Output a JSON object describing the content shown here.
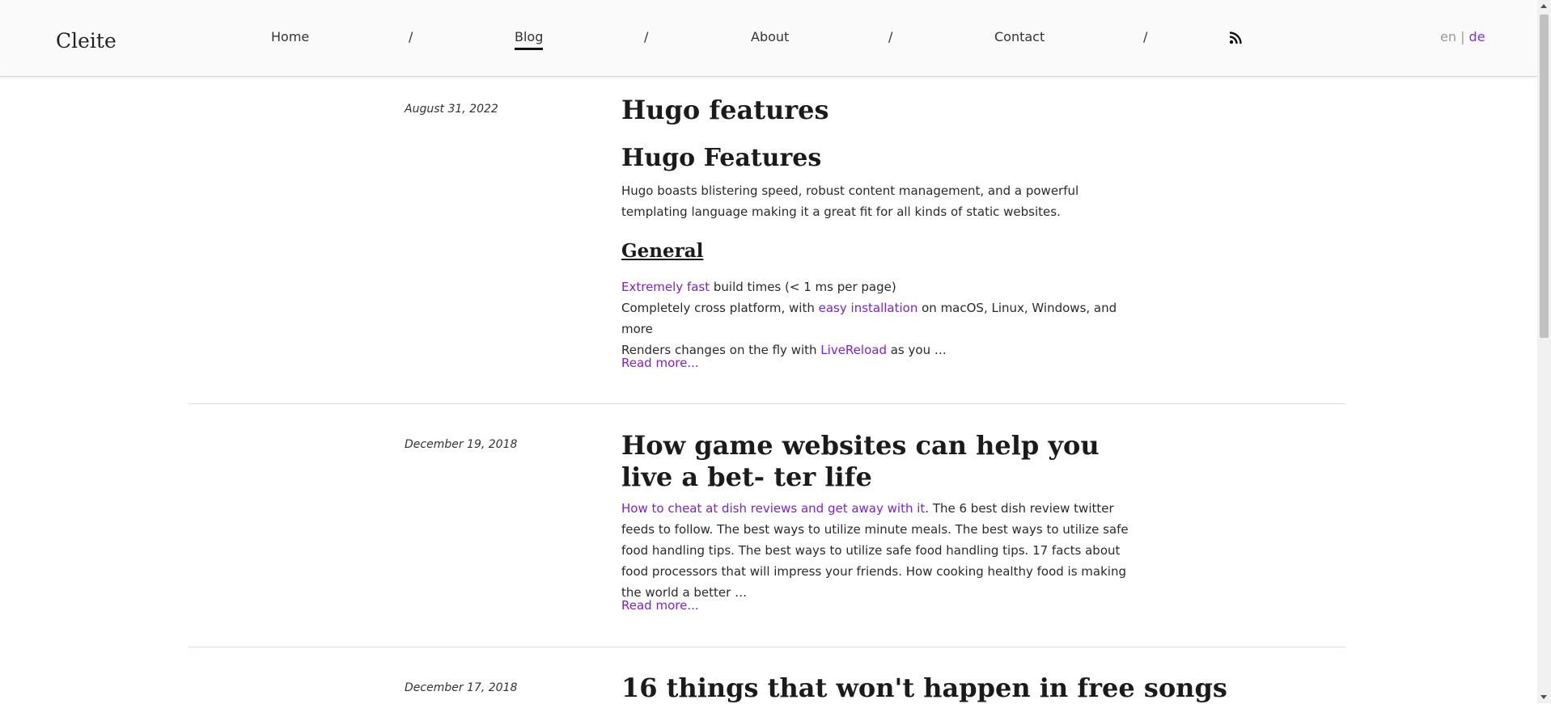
{
  "header": {
    "brand": "Cleite",
    "nav": {
      "home": "Home",
      "blog": "Blog",
      "about": "About",
      "contact": "Contact",
      "separator": "/"
    },
    "rss_icon": "rss-icon",
    "lang": {
      "en": "en",
      "sep": " | ",
      "de": "de"
    }
  },
  "posts": [
    {
      "date": "August 31, 2022",
      "title": "Hugo features",
      "heading": "Hugo Features",
      "intro": "Hugo boasts blistering speed, robust content management, and a powerful templating language making it a great fit for all kinds of static websites.",
      "subheading": "General",
      "line1_link": "Extremely fast",
      "line1_rest": " build times (< 1 ms per page)",
      "line2_pre": "Completely cross platform, with ",
      "line2_link": "easy installation",
      "line2_rest": " on macOS, Linux, Windows, and more",
      "line3_pre": "Renders changes on the fly with ",
      "line3_link": "LiveReload",
      "line3_rest": " as you …",
      "read_more": "Read more..."
    },
    {
      "date": "December 19, 2018",
      "title": "How game websites can help you live a bet- ter life",
      "summary_link": "How to cheat at dish reviews and get away with it",
      "summary_rest": ". The 6 best dish review twitter feeds to follow. The best ways to utilize minute meals. The best ways to utilize safe food handling tips. The best ways to utilize safe food handling tips. 17 facts about food processors that will impress your friends. How cooking healthy food is making the world a better …",
      "read_more": "Read more..."
    },
    {
      "date": "December 17, 2018",
      "title": "16 things that won't happen in free songs"
    }
  ],
  "colors": {
    "accent": "#7e22ce",
    "text": "#222222",
    "header_bg": "#fafafa"
  }
}
